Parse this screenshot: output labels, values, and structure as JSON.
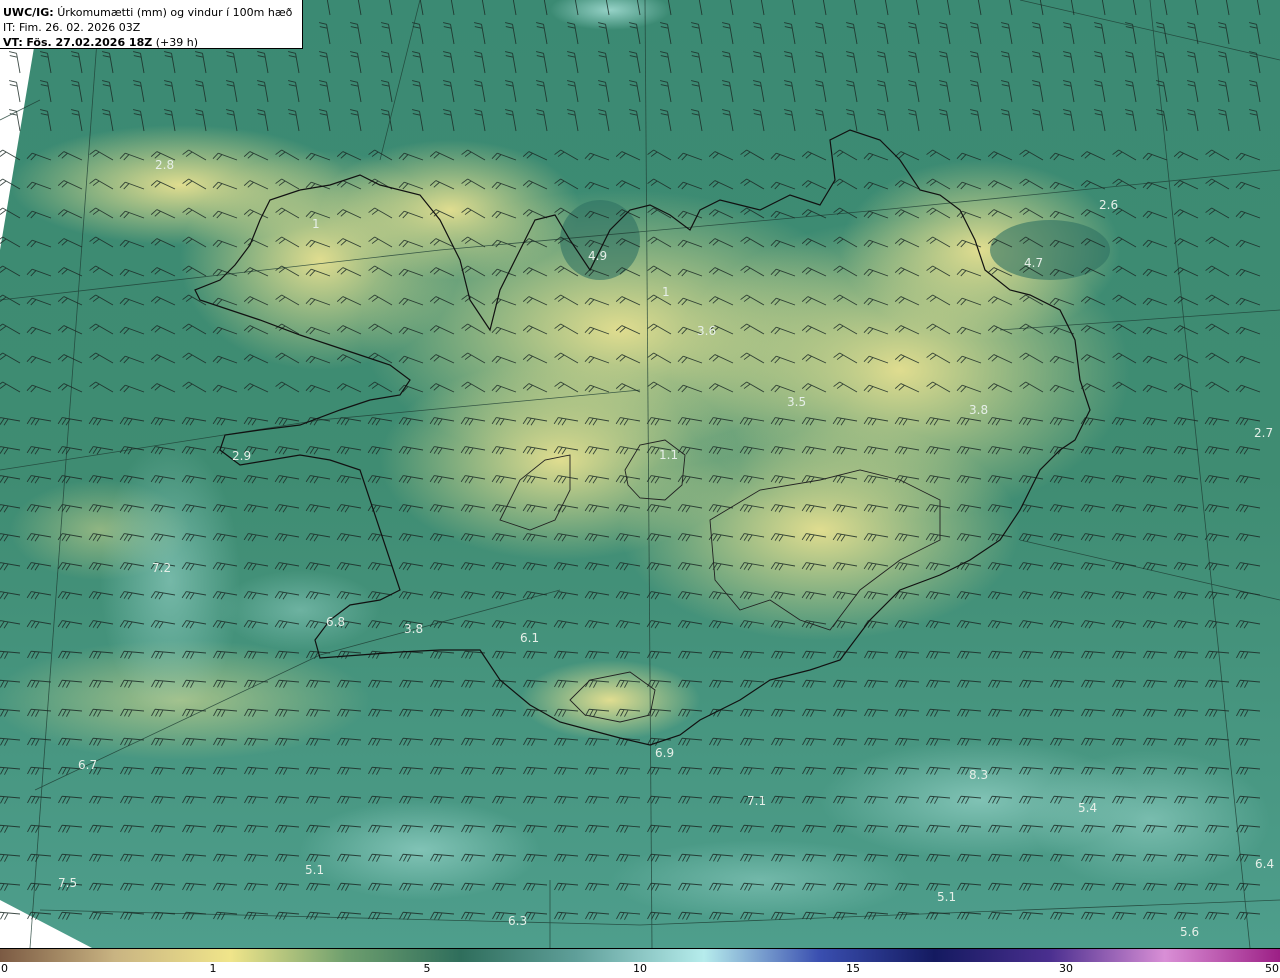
{
  "title": {
    "model": "UWC/IG:",
    "description": "Úrkomumætti (mm) og vindur í 100m hæð",
    "init_label": "IT:",
    "init_time": "Fim. 26. 02. 2026 03Z",
    "valid_label": "VT:",
    "valid_time": "Fös. 27.02.2026 18Z",
    "lead": "(+39 h)"
  },
  "colorbar": {
    "ticks": [
      "0",
      "1",
      "5",
      "10",
      "15",
      "30",
      "50"
    ],
    "colors": [
      "#7b5a43",
      "#c9b482",
      "#f0e58a",
      "#6e9f6e",
      "#2f6e5c",
      "#5f9f99",
      "#b6ecec",
      "#3a4fb0",
      "#141a60",
      "#4a2f8f",
      "#d98fd6",
      "#9c1f85"
    ]
  },
  "labels": [
    {
      "text": "2.8",
      "place": "nw-sea"
    },
    {
      "text": "1",
      "place": "westfjords"
    },
    {
      "text": "4.9",
      "place": "north-fjord"
    },
    {
      "text": "1",
      "place": "north-highlands"
    },
    {
      "text": "3.6",
      "place": "north"
    },
    {
      "text": "3.5",
      "place": "central-north"
    },
    {
      "text": "3.8",
      "place": "east"
    },
    {
      "text": "4.7",
      "place": "northeast"
    },
    {
      "text": "2.6",
      "place": "ne-sea"
    },
    {
      "text": "2.7",
      "place": "east-sea"
    },
    {
      "text": "2.9",
      "place": "snaefellsnes"
    },
    {
      "text": "1.1",
      "place": "hofsjokull"
    },
    {
      "text": "7.2",
      "place": "west-sea"
    },
    {
      "text": "6.8",
      "place": "reykjanes"
    },
    {
      "text": "3.8",
      "place": "southwest"
    },
    {
      "text": "6.1",
      "place": "south"
    },
    {
      "text": "6.9",
      "place": "south-coast"
    },
    {
      "text": "6.7",
      "place": "sw-sea"
    },
    {
      "text": "7.1",
      "place": "south-sea"
    },
    {
      "text": "8.3",
      "place": "se-sea"
    },
    {
      "text": "5.4",
      "place": "se-sea-2"
    },
    {
      "text": "5.1",
      "place": "far-south-1"
    },
    {
      "text": "5.1",
      "place": "far-south-2"
    },
    {
      "text": "7.5",
      "place": "far-sw"
    },
    {
      "text": "5.6",
      "place": "far-se"
    },
    {
      "text": "6.3",
      "place": "far-south-3"
    },
    {
      "text": "6.4",
      "place": "east-edge"
    }
  ]
}
